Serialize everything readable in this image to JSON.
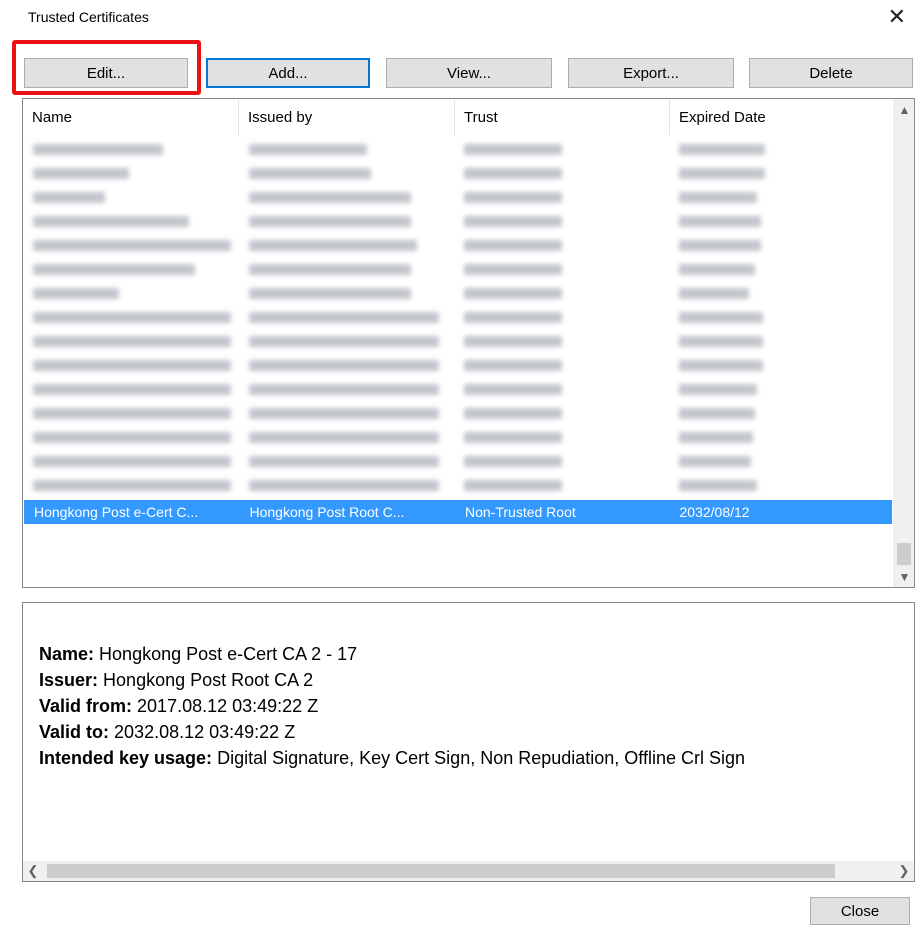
{
  "window": {
    "title": "Trusted Certificates",
    "close_glyph": "✕"
  },
  "toolbar": {
    "edit_label": "Edit...",
    "add_label": "Add...",
    "view_label": "View...",
    "export_label": "Export...",
    "delete_label": "Delete"
  },
  "table": {
    "columns": [
      "Name",
      "Issued by",
      "Trust",
      "Expired Date"
    ],
    "blurred_rows": [
      [
        130,
        118,
        98,
        86
      ],
      [
        96,
        122,
        98,
        86
      ],
      [
        72,
        162,
        98,
        78
      ],
      [
        156,
        162,
        98,
        82
      ],
      [
        198,
        168,
        98,
        82
      ],
      [
        162,
        162,
        98,
        76
      ],
      [
        86,
        162,
        98,
        70
      ],
      [
        198,
        190,
        98,
        84
      ],
      [
        198,
        190,
        98,
        84
      ],
      [
        198,
        190,
        98,
        84
      ],
      [
        198,
        190,
        98,
        78
      ],
      [
        198,
        190,
        98,
        76
      ],
      [
        198,
        190,
        98,
        74
      ],
      [
        198,
        190,
        98,
        72
      ],
      [
        198,
        190,
        98,
        78
      ]
    ],
    "selected_row": {
      "name": "Hongkong Post e-Cert C...",
      "issued_by": "Hongkong Post Root C...",
      "trust": "Non-Trusted Root",
      "expired": "2032/08/12"
    }
  },
  "details": {
    "name_label": "Name:",
    "name_value": "Hongkong Post e-Cert CA 2 - 17",
    "issuer_label": "Issuer:",
    "issuer_value": "Hongkong Post Root CA 2",
    "valid_from_label": "Valid from:",
    "valid_from_value": "2017.08.12 03:49:22 Z",
    "valid_to_label": "Valid to:",
    "valid_to_value": "2032.08.12 03:49:22 Z",
    "usage_label": "Intended key usage:",
    "usage_value": "Digital Signature, Key Cert Sign, Non Repudiation, Offline Crl Sign"
  },
  "footer": {
    "close_label": "Close"
  },
  "colors": {
    "selection": "#3399ff",
    "highlight": "#ee1111",
    "focus_border": "#0078d7"
  }
}
